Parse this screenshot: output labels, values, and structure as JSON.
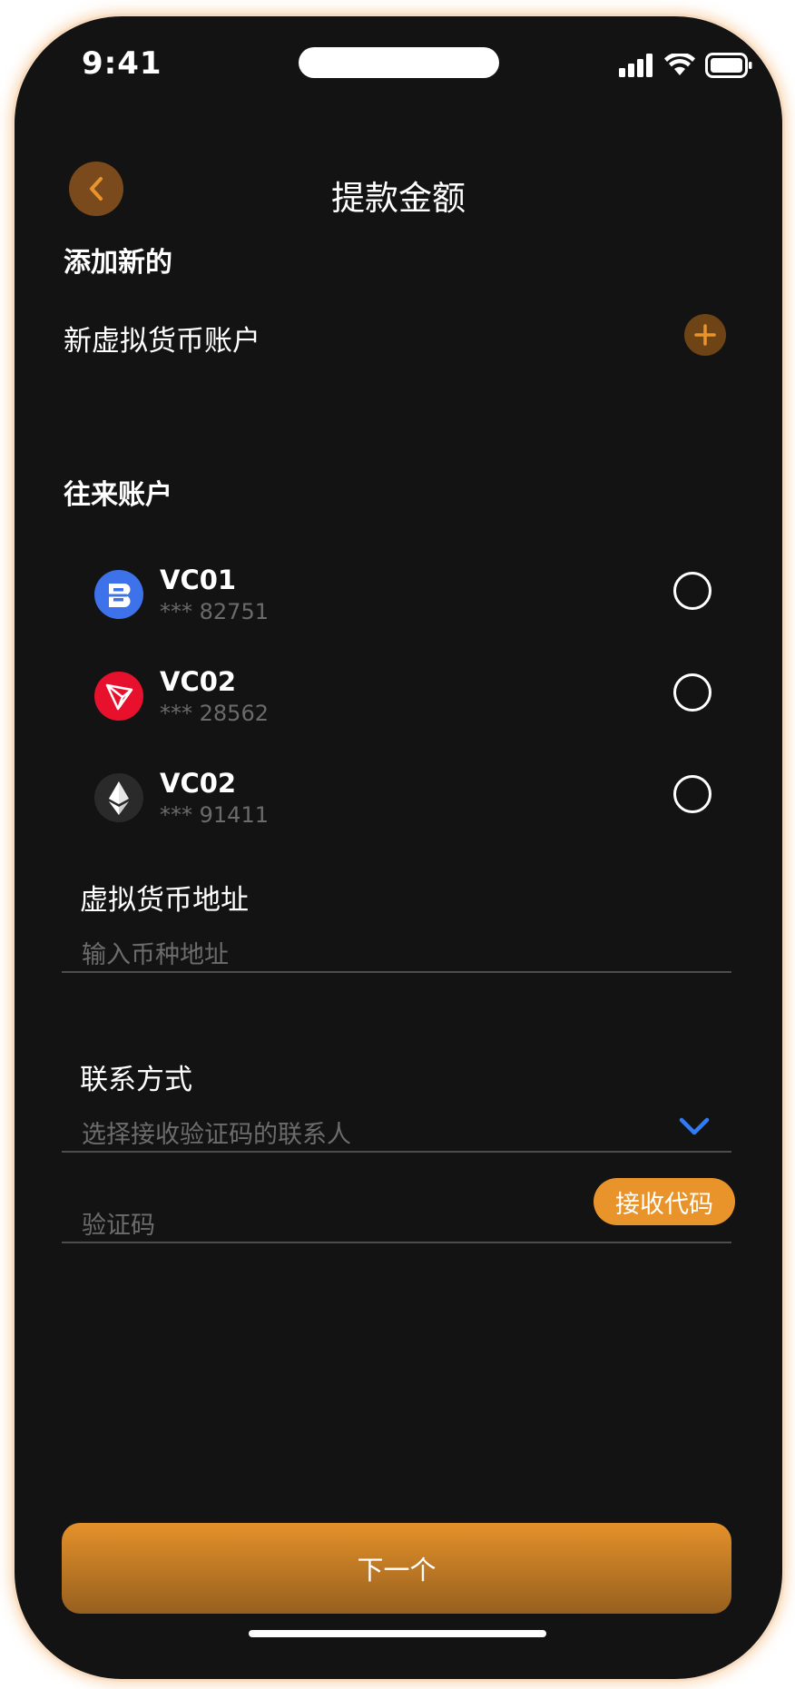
{
  "status_bar": {
    "time": "9:41"
  },
  "header": {
    "title": "提款金额"
  },
  "add_new": {
    "heading": "添加新的",
    "new_account_label": "新虚拟货币账户"
  },
  "accounts": {
    "heading": "往来账户",
    "items": [
      {
        "name": "VC01",
        "number": "*** 82751",
        "icon": "coin-b-icon",
        "color": "#3d72ea"
      },
      {
        "name": "VC02",
        "number": "*** 28562",
        "icon": "tron-icon",
        "color": "#e8112d"
      },
      {
        "name": "VC02",
        "number": "*** 91411",
        "icon": "ethereum-icon",
        "color": "#2a2a2a"
      }
    ]
  },
  "address": {
    "label": "虚拟货币地址",
    "placeholder": "输入币种地址"
  },
  "contact": {
    "label": "联系方式",
    "placeholder": "选择接收验证码的联系人"
  },
  "verification": {
    "placeholder": "验证码",
    "button_label": "接收代码"
  },
  "footer": {
    "next_label": "下一个"
  },
  "colors": {
    "accent": "#e8942b",
    "background": "#131313",
    "dropdown": "#2f7cf6"
  }
}
